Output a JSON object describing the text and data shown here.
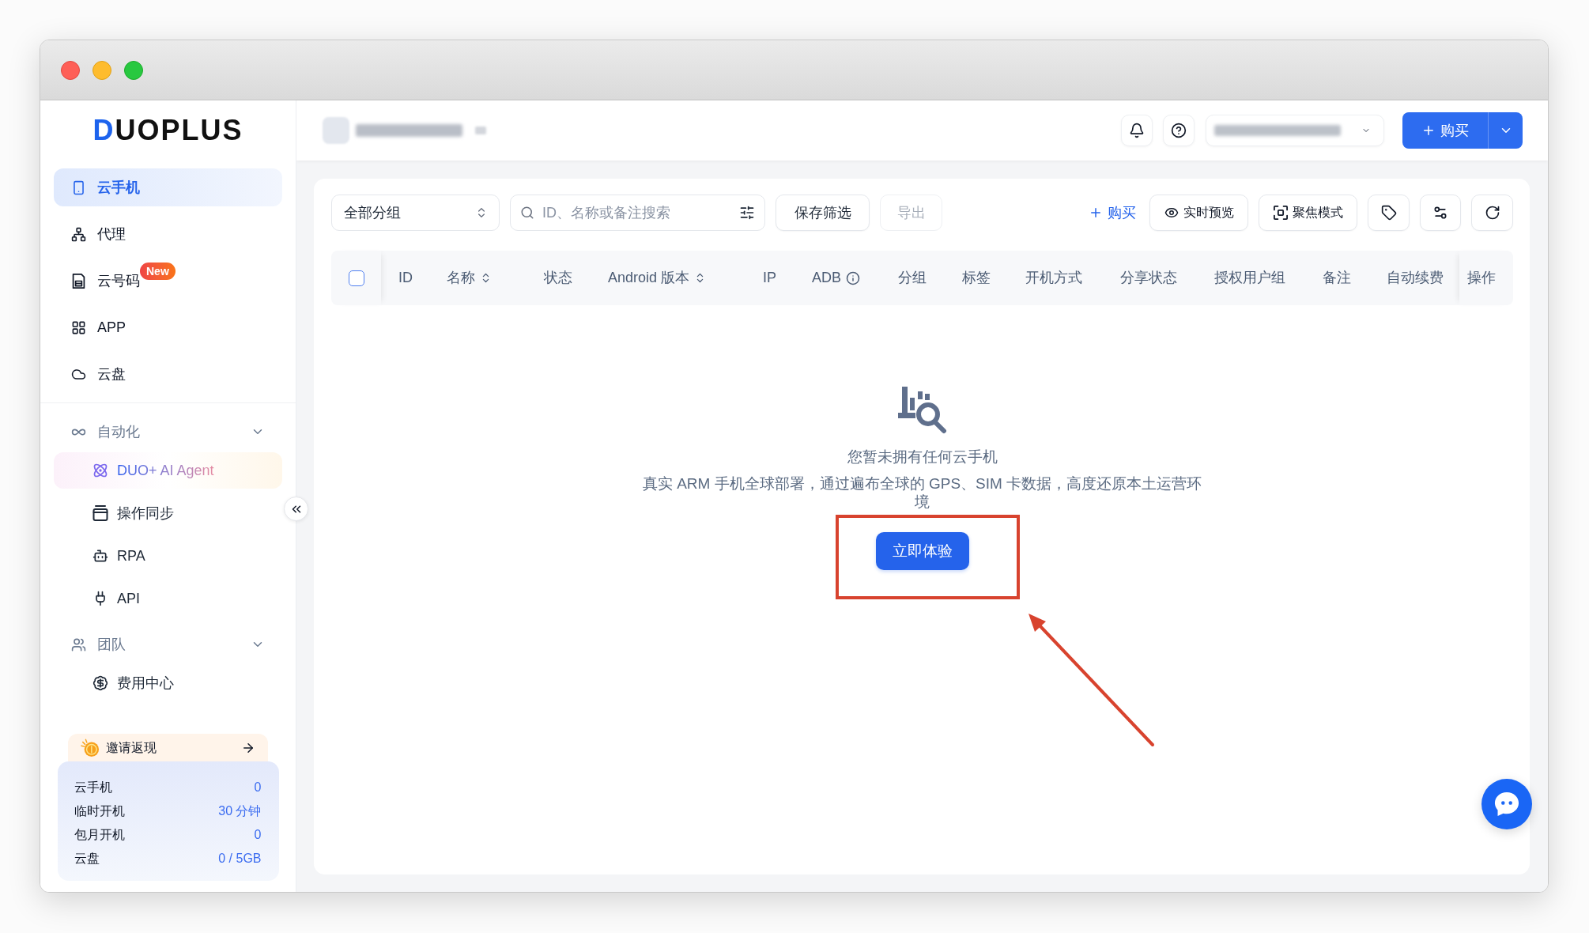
{
  "sidebar": {
    "logo": "DUOPLUS",
    "items": [
      {
        "label": "云手机",
        "selected": true
      },
      {
        "label": "代理",
        "selected": false
      },
      {
        "label": "云号码",
        "selected": false,
        "badge": "New"
      },
      {
        "label": "APP",
        "selected": false
      },
      {
        "label": "云盘",
        "selected": false
      }
    ],
    "groups": [
      {
        "label": "自动化",
        "expanded": true,
        "children": [
          {
            "label": "DUO+ AI Agent",
            "kind": "featured",
            "selected": false
          },
          {
            "label": "操作同步",
            "kind": "link",
            "selected": false
          },
          {
            "label": "RPA",
            "kind": "link",
            "selected": false
          },
          {
            "label": "API",
            "kind": "link",
            "selected": false
          }
        ]
      },
      {
        "label": "团队",
        "expanded": true,
        "children": [
          {
            "label": "费用中心",
            "kind": "link",
            "selected": false
          }
        ]
      }
    ],
    "invite": {
      "label": "邀请返现"
    },
    "stats": [
      {
        "label": "云手机",
        "value": "0"
      },
      {
        "label": "临时开机",
        "value": "30 分钟"
      },
      {
        "label": "包月开机",
        "value": "0"
      },
      {
        "label": "云盘",
        "value": "0 / 5GB"
      }
    ]
  },
  "topbar": {
    "buy_button": {
      "label": "购买"
    }
  },
  "toolbar": {
    "group_select": {
      "value": "全部分组"
    },
    "search": {
      "placeholder": "ID、名称或备注搜索"
    },
    "buttons": [
      {
        "label": "保存筛选",
        "disabled": false
      },
      {
        "label": "导出",
        "disabled": true
      }
    ],
    "buy_link": {
      "label": "购买"
    },
    "view_buttons": [
      {
        "label": "实时预览"
      },
      {
        "label": "聚焦模式"
      }
    ]
  },
  "table": {
    "select_all": {
      "checked": false
    },
    "columns": [
      {
        "label": "ID",
        "kind": "plain"
      },
      {
        "label": "名称",
        "kind": "sortable"
      },
      {
        "label": "状态",
        "kind": "plain"
      },
      {
        "label": "Android 版本",
        "kind": "sortable"
      },
      {
        "label": "IP",
        "kind": "plain"
      },
      {
        "label": "ADB",
        "kind": "info"
      },
      {
        "label": "分组",
        "kind": "plain"
      },
      {
        "label": "标签",
        "kind": "plain"
      },
      {
        "label": "开机方式",
        "kind": "plain"
      },
      {
        "label": "分享状态",
        "kind": "plain"
      },
      {
        "label": "授权用户组",
        "kind": "plain"
      },
      {
        "label": "备注",
        "kind": "plain"
      },
      {
        "label": "自动续费",
        "kind": "plain"
      },
      {
        "label": "操作",
        "kind": "plain"
      }
    ]
  },
  "empty_state": {
    "title": "您暂未拥有任何云手机",
    "description": "真实 ARM 手机全球部署，通过遍布全球的 GPS、SIM 卡数据，高度还原本土运营环境",
    "button": "立即体验"
  }
}
